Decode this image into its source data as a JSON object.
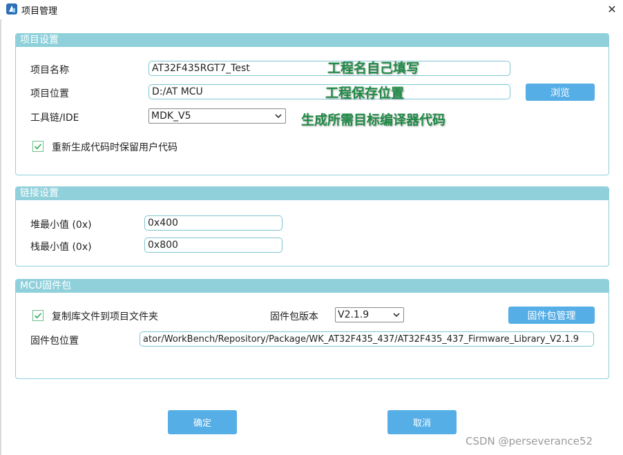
{
  "window": {
    "title": "项目管理",
    "close_icon": "close-icon"
  },
  "project_settings": {
    "header": "项目设置",
    "name_label": "项目名称",
    "name_value": "AT32F435RGT7_Test",
    "location_label": "项目位置",
    "location_value": "D:/AT MCU",
    "browse_label": "浏览",
    "toolchain_label": "工具链/IDE",
    "toolchain_value": "MDK_V5",
    "regen_checkbox_label": "重新生成代码时保留用户代码",
    "regen_checked": true
  },
  "annotations": {
    "name_hint": "工程名自己填写",
    "location_hint": "工程保存位置",
    "toolchain_hint": "生成所需目标编译器代码"
  },
  "link_settings": {
    "header": "链接设置",
    "heap_label": "堆最小值 (0x)",
    "heap_value": "0x400",
    "stack_label": "栈最小值 (0x)",
    "stack_value": "0x800"
  },
  "firmware": {
    "header": "MCU固件包",
    "copy_checkbox_label": "复制库文件到项目文件夹",
    "copy_checked": true,
    "version_label": "固件包版本",
    "version_value": "V2.1.9",
    "manage_label": "固件包管理",
    "location_label": "固件包位置",
    "location_value": "ator/WorkBench/Repository/Package/WK_AT32F435_437/AT32F435_437_Firmware_Library_V2.1.9"
  },
  "footer": {
    "ok_label": "确定",
    "cancel_label": "取消"
  },
  "watermark": "CSDN @perseverance52",
  "colors": {
    "group_header": "#8fd0db",
    "button": "#55aee6",
    "annotation": "#1e8a45",
    "checkbox_border": "#6cc08a"
  }
}
